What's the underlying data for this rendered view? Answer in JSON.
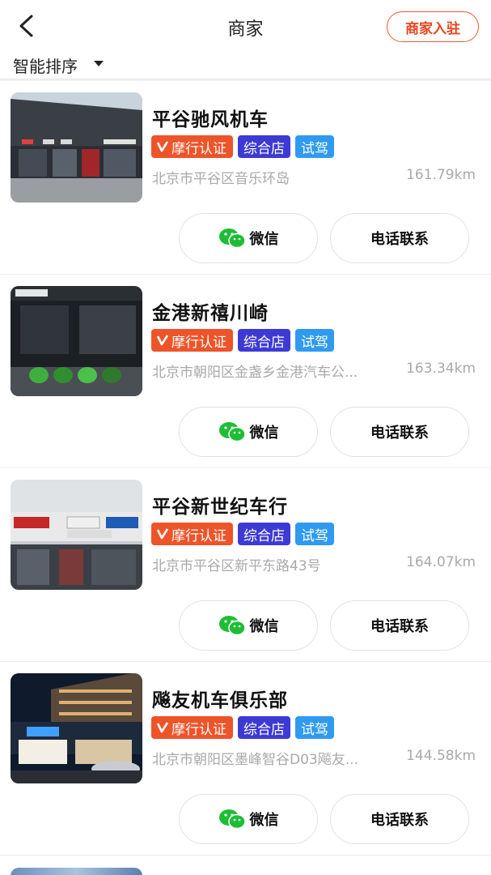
{
  "header": {
    "title": "商家",
    "join_label": "商家入驻"
  },
  "sort": {
    "label": "智能排序"
  },
  "colors": {
    "accent": "#ee5429",
    "tag_type": "#3d3ad4",
    "tag_test": "#2f9af0",
    "wechat_green": "#1fbd35"
  },
  "shops": [
    {
      "name": "平谷驰风机车",
      "tags": {
        "cert": "摩行认证",
        "type": "综合店",
        "test": "试驾"
      },
      "address": "北京市平谷区音乐环岛",
      "distance": "161.79km",
      "wechat_label": "微信",
      "phone_label": "电话联系"
    },
    {
      "name": "金港新禧川崎",
      "tags": {
        "cert": "摩行认证",
        "type": "综合店",
        "test": "试驾"
      },
      "address": "北京市朝阳区金盏乡金港汽车公...",
      "distance": "163.34km",
      "wechat_label": "微信",
      "phone_label": "电话联系"
    },
    {
      "name": "平谷新世纪车行",
      "tags": {
        "cert": "摩行认证",
        "type": "综合店",
        "test": "试驾"
      },
      "address": "北京市平谷区新平东路43号",
      "distance": "164.07km",
      "wechat_label": "微信",
      "phone_label": "电话联系"
    },
    {
      "name": "飚友机车俱乐部",
      "tags": {
        "cert": "摩行认证",
        "type": "综合店",
        "test": "试驾"
      },
      "address": "北京市朝阳区墨峰智谷D03飚友...",
      "distance": "144.58km",
      "wechat_label": "微信",
      "phone_label": "电话联系"
    }
  ]
}
